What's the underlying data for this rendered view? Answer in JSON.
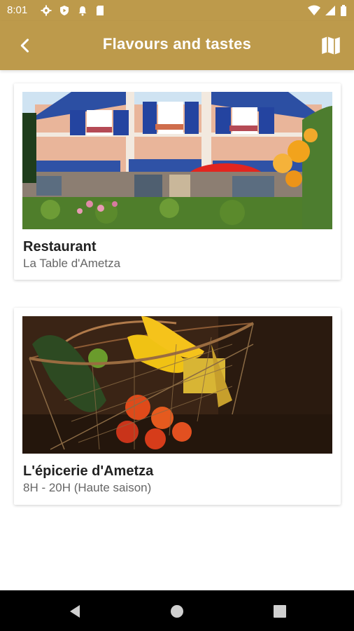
{
  "status_bar": {
    "time": "8:01",
    "icons": [
      "settings-icon",
      "shield-icon",
      "notification-bell-icon",
      "sd-card-icon",
      "wifi-icon",
      "cell-signal-icon",
      "battery-icon"
    ]
  },
  "app_bar": {
    "title": "Flavours and tastes",
    "back_icon": "arrow-back-icon",
    "map_icon": "map-icon",
    "color": "#bd9a4b"
  },
  "cards": [
    {
      "title": "Restaurant",
      "subtitle": "La Table d'Ametza",
      "image": "restaurant-facade-photo"
    },
    {
      "title": "L'épicerie d'Ametza",
      "subtitle": "8H - 20H (Haute saison)",
      "image": "vegetable-basket-photo"
    }
  ],
  "nav_bar": {
    "icons": [
      "back-triangle-icon",
      "home-circle-icon",
      "recents-square-icon"
    ]
  }
}
